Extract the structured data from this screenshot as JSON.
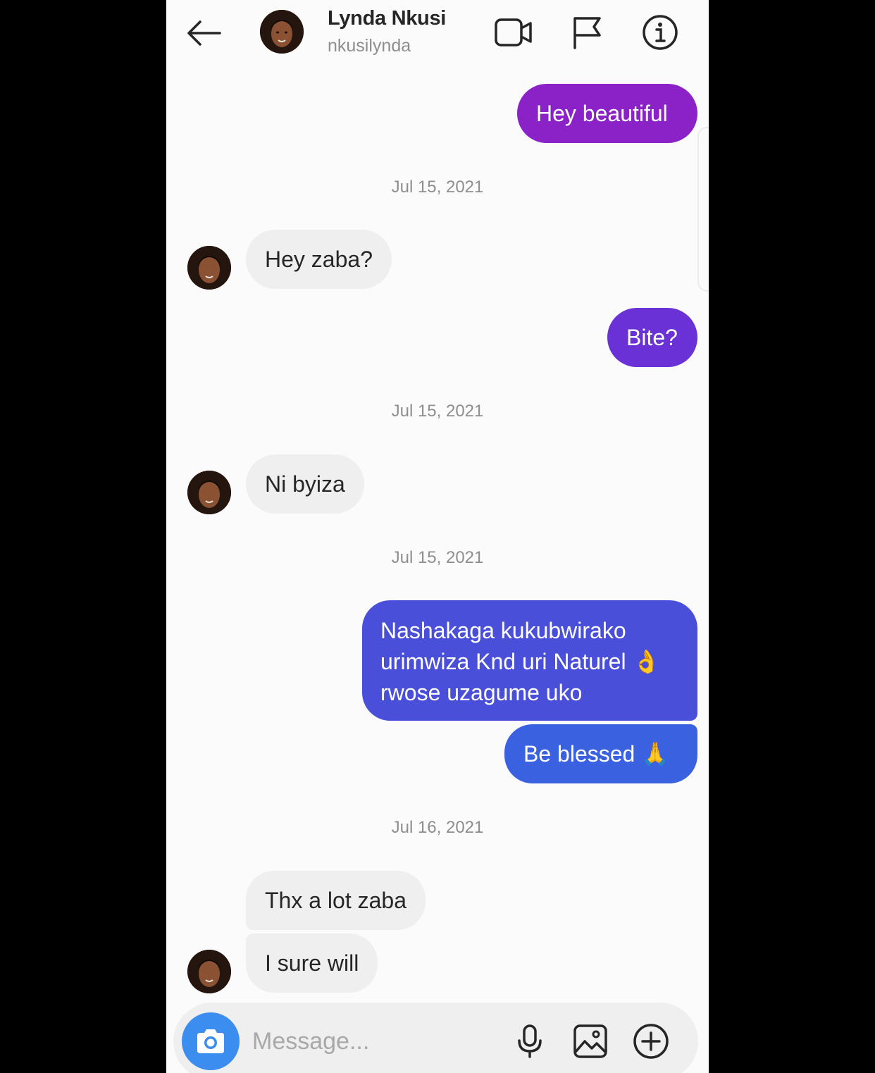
{
  "header": {
    "back_icon": "arrow-left-icon",
    "name": "Lynda Nkusi",
    "username": "nkusilynda",
    "actions": [
      "video-icon",
      "flag-icon",
      "info-icon"
    ]
  },
  "messages": {
    "m1": "Hey beautiful",
    "ts1": "Jul 15, 2021",
    "m2": "Hey zaba?",
    "m3": "Bite?",
    "ts2": "Jul 15, 2021",
    "m4": "Ni byiza",
    "ts3": "Jul 15, 2021",
    "m5_line1": "Nashakaga kukubwirako",
    "m5_line2": "urimwiza Knd uri Naturel 👌",
    "m5_line3": "rwose uzagume uko",
    "m6": "Be blessed 🙏",
    "ts4": "Jul 16, 2021",
    "m7": "Thx a lot zaba",
    "m8": "I sure will"
  },
  "composer": {
    "placeholder": "Message...",
    "icons": [
      "camera-icon",
      "microphone-icon",
      "gallery-icon",
      "plus-circle-icon"
    ]
  },
  "colors": {
    "bubble_purple": "#8a22c8",
    "bubble_violet": "#6a32d6",
    "bubble_indigo": "#4a4fda",
    "bubble_blue": "#3a62e0",
    "incoming_bg": "#efefef",
    "camera_blue": "#3c8df0"
  }
}
